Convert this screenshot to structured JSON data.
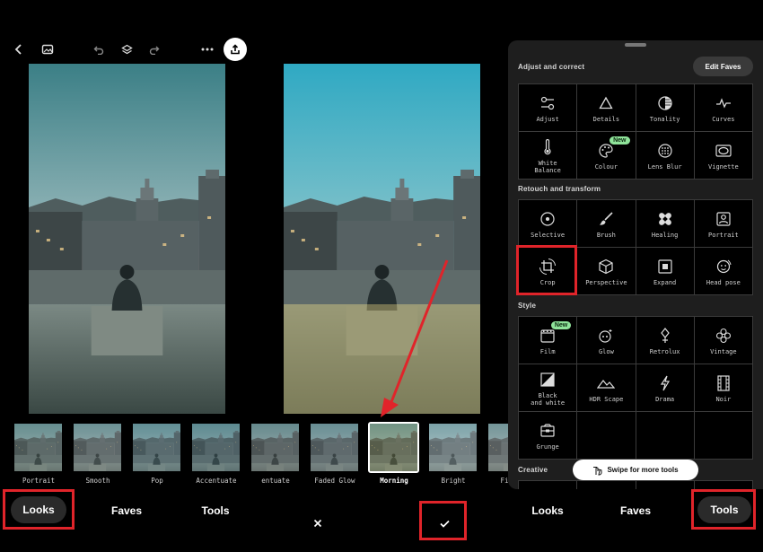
{
  "toolbar": {
    "icons": [
      "back-icon",
      "gallery-icon",
      "undo-icon",
      "layers-icon",
      "redo-icon",
      "more-icon",
      "share-icon"
    ]
  },
  "filmstrip": [
    {
      "label": "Portrait",
      "tint": "#6b7a76"
    },
    {
      "label": "Smooth",
      "tint": "#7a8584"
    },
    {
      "label": "Pop",
      "tint": "#5f7f86"
    },
    {
      "label": "Accentuate",
      "tint": "#4f6f78"
    },
    {
      "label": "entuate",
      "tint": "#6a7170"
    },
    {
      "label": "Faded Glow",
      "tint": "#6f7a82"
    },
    {
      "label": "Morning",
      "tint": "#8a8a52",
      "selected": true
    },
    {
      "label": "Bright",
      "tint": "#a9b8bc"
    },
    {
      "label": "Fine A",
      "tint": "#8f8f8f"
    }
  ],
  "bottom_nav_left": {
    "looks": "Looks",
    "faves": "Faves",
    "tools": "Tools"
  },
  "bottom_nav_right": {
    "looks": "Looks",
    "faves": "Faves",
    "tools": "Tools"
  },
  "actions": {
    "cancel_icon": "close-icon",
    "confirm_icon": "check-icon"
  },
  "panel": {
    "sections": [
      {
        "title": "Adjust and correct"
      },
      {
        "title": "Retouch and transform"
      },
      {
        "title": "Style"
      },
      {
        "title": "Creative"
      }
    ],
    "edit_faves": "Edit Faves",
    "adjust": [
      {
        "label": "Adjust",
        "icon": "sliders-icon"
      },
      {
        "label": "Details",
        "icon": "triangle-icon"
      },
      {
        "label": "Tonality",
        "icon": "tonality-icon"
      },
      {
        "label": "Curves",
        "icon": "curves-icon"
      },
      {
        "label": "White\nBalance",
        "icon": "thermometer-icon"
      },
      {
        "label": "Colour",
        "icon": "palette-icon",
        "badge": "New"
      },
      {
        "label": "Lens Blur",
        "icon": "lens-blur-icon"
      },
      {
        "label": "Vignette",
        "icon": "vignette-icon"
      }
    ],
    "retouch": [
      {
        "label": "Selective",
        "icon": "target-icon"
      },
      {
        "label": "Brush",
        "icon": "brush-icon"
      },
      {
        "label": "Healing",
        "icon": "bandage-icon"
      },
      {
        "label": "Portrait",
        "icon": "portrait-icon"
      },
      {
        "label": "Crop",
        "icon": "crop-rotate-icon"
      },
      {
        "label": "Perspective",
        "icon": "cube-icon"
      },
      {
        "label": "Expand",
        "icon": "expand-icon"
      },
      {
        "label": "Head pose",
        "icon": "head-pose-icon"
      }
    ],
    "style": [
      {
        "label": "Film",
        "icon": "film-icon",
        "badge": "New"
      },
      {
        "label": "Glow",
        "icon": "glow-icon"
      },
      {
        "label": "Retrolux",
        "icon": "retrolux-icon"
      },
      {
        "label": "Vintage",
        "icon": "vintage-icon"
      },
      {
        "label": "Black\nand white",
        "icon": "black-white-icon"
      },
      {
        "label": "HDR Scape",
        "icon": "mountains-icon"
      },
      {
        "label": "Drama",
        "icon": "lightning-icon"
      },
      {
        "label": "Noir",
        "icon": "film-strip-icon"
      },
      {
        "label": "Grunge",
        "icon": "grunge-icon"
      },
      {
        "label": "",
        "icon": ""
      },
      {
        "label": "",
        "icon": ""
      },
      {
        "label": "",
        "icon": ""
      }
    ],
    "swipe_hint": "Swipe for more tools"
  },
  "colors": {
    "highlight": "#e0242a",
    "badge": "#8fe39a",
    "panel_bg": "#1e1e1e"
  }
}
